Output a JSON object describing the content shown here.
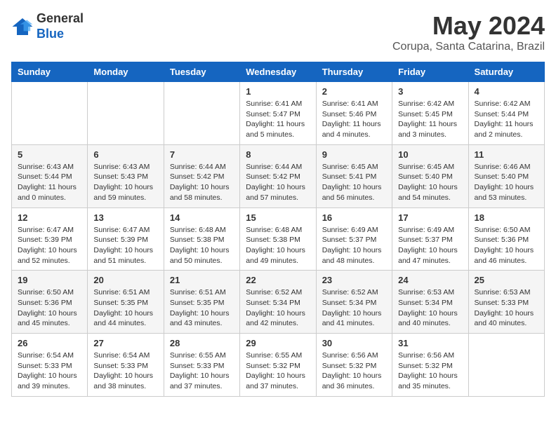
{
  "logo": {
    "general": "General",
    "blue": "Blue"
  },
  "title": "May 2024",
  "location": "Corupa, Santa Catarina, Brazil",
  "weekdays": [
    "Sunday",
    "Monday",
    "Tuesday",
    "Wednesday",
    "Thursday",
    "Friday",
    "Saturday"
  ],
  "weeks": [
    [
      {
        "day": "",
        "sunrise": "",
        "sunset": "",
        "daylight": ""
      },
      {
        "day": "",
        "sunrise": "",
        "sunset": "",
        "daylight": ""
      },
      {
        "day": "",
        "sunrise": "",
        "sunset": "",
        "daylight": ""
      },
      {
        "day": "1",
        "sunrise": "Sunrise: 6:41 AM",
        "sunset": "Sunset: 5:47 PM",
        "daylight": "Daylight: 11 hours and 5 minutes."
      },
      {
        "day": "2",
        "sunrise": "Sunrise: 6:41 AM",
        "sunset": "Sunset: 5:46 PM",
        "daylight": "Daylight: 11 hours and 4 minutes."
      },
      {
        "day": "3",
        "sunrise": "Sunrise: 6:42 AM",
        "sunset": "Sunset: 5:45 PM",
        "daylight": "Daylight: 11 hours and 3 minutes."
      },
      {
        "day": "4",
        "sunrise": "Sunrise: 6:42 AM",
        "sunset": "Sunset: 5:44 PM",
        "daylight": "Daylight: 11 hours and 2 minutes."
      }
    ],
    [
      {
        "day": "5",
        "sunrise": "Sunrise: 6:43 AM",
        "sunset": "Sunset: 5:44 PM",
        "daylight": "Daylight: 11 hours and 0 minutes."
      },
      {
        "day": "6",
        "sunrise": "Sunrise: 6:43 AM",
        "sunset": "Sunset: 5:43 PM",
        "daylight": "Daylight: 10 hours and 59 minutes."
      },
      {
        "day": "7",
        "sunrise": "Sunrise: 6:44 AM",
        "sunset": "Sunset: 5:42 PM",
        "daylight": "Daylight: 10 hours and 58 minutes."
      },
      {
        "day": "8",
        "sunrise": "Sunrise: 6:44 AM",
        "sunset": "Sunset: 5:42 PM",
        "daylight": "Daylight: 10 hours and 57 minutes."
      },
      {
        "day": "9",
        "sunrise": "Sunrise: 6:45 AM",
        "sunset": "Sunset: 5:41 PM",
        "daylight": "Daylight: 10 hours and 56 minutes."
      },
      {
        "day": "10",
        "sunrise": "Sunrise: 6:45 AM",
        "sunset": "Sunset: 5:40 PM",
        "daylight": "Daylight: 10 hours and 54 minutes."
      },
      {
        "day": "11",
        "sunrise": "Sunrise: 6:46 AM",
        "sunset": "Sunset: 5:40 PM",
        "daylight": "Daylight: 10 hours and 53 minutes."
      }
    ],
    [
      {
        "day": "12",
        "sunrise": "Sunrise: 6:47 AM",
        "sunset": "Sunset: 5:39 PM",
        "daylight": "Daylight: 10 hours and 52 minutes."
      },
      {
        "day": "13",
        "sunrise": "Sunrise: 6:47 AM",
        "sunset": "Sunset: 5:39 PM",
        "daylight": "Daylight: 10 hours and 51 minutes."
      },
      {
        "day": "14",
        "sunrise": "Sunrise: 6:48 AM",
        "sunset": "Sunset: 5:38 PM",
        "daylight": "Daylight: 10 hours and 50 minutes."
      },
      {
        "day": "15",
        "sunrise": "Sunrise: 6:48 AM",
        "sunset": "Sunset: 5:38 PM",
        "daylight": "Daylight: 10 hours and 49 minutes."
      },
      {
        "day": "16",
        "sunrise": "Sunrise: 6:49 AM",
        "sunset": "Sunset: 5:37 PM",
        "daylight": "Daylight: 10 hours and 48 minutes."
      },
      {
        "day": "17",
        "sunrise": "Sunrise: 6:49 AM",
        "sunset": "Sunset: 5:37 PM",
        "daylight": "Daylight: 10 hours and 47 minutes."
      },
      {
        "day": "18",
        "sunrise": "Sunrise: 6:50 AM",
        "sunset": "Sunset: 5:36 PM",
        "daylight": "Daylight: 10 hours and 46 minutes."
      }
    ],
    [
      {
        "day": "19",
        "sunrise": "Sunrise: 6:50 AM",
        "sunset": "Sunset: 5:36 PM",
        "daylight": "Daylight: 10 hours and 45 minutes."
      },
      {
        "day": "20",
        "sunrise": "Sunrise: 6:51 AM",
        "sunset": "Sunset: 5:35 PM",
        "daylight": "Daylight: 10 hours and 44 minutes."
      },
      {
        "day": "21",
        "sunrise": "Sunrise: 6:51 AM",
        "sunset": "Sunset: 5:35 PM",
        "daylight": "Daylight: 10 hours and 43 minutes."
      },
      {
        "day": "22",
        "sunrise": "Sunrise: 6:52 AM",
        "sunset": "Sunset: 5:34 PM",
        "daylight": "Daylight: 10 hours and 42 minutes."
      },
      {
        "day": "23",
        "sunrise": "Sunrise: 6:52 AM",
        "sunset": "Sunset: 5:34 PM",
        "daylight": "Daylight: 10 hours and 41 minutes."
      },
      {
        "day": "24",
        "sunrise": "Sunrise: 6:53 AM",
        "sunset": "Sunset: 5:34 PM",
        "daylight": "Daylight: 10 hours and 40 minutes."
      },
      {
        "day": "25",
        "sunrise": "Sunrise: 6:53 AM",
        "sunset": "Sunset: 5:33 PM",
        "daylight": "Daylight: 10 hours and 40 minutes."
      }
    ],
    [
      {
        "day": "26",
        "sunrise": "Sunrise: 6:54 AM",
        "sunset": "Sunset: 5:33 PM",
        "daylight": "Daylight: 10 hours and 39 minutes."
      },
      {
        "day": "27",
        "sunrise": "Sunrise: 6:54 AM",
        "sunset": "Sunset: 5:33 PM",
        "daylight": "Daylight: 10 hours and 38 minutes."
      },
      {
        "day": "28",
        "sunrise": "Sunrise: 6:55 AM",
        "sunset": "Sunset: 5:33 PM",
        "daylight": "Daylight: 10 hours and 37 minutes."
      },
      {
        "day": "29",
        "sunrise": "Sunrise: 6:55 AM",
        "sunset": "Sunset: 5:32 PM",
        "daylight": "Daylight: 10 hours and 37 minutes."
      },
      {
        "day": "30",
        "sunrise": "Sunrise: 6:56 AM",
        "sunset": "Sunset: 5:32 PM",
        "daylight": "Daylight: 10 hours and 36 minutes."
      },
      {
        "day": "31",
        "sunrise": "Sunrise: 6:56 AM",
        "sunset": "Sunset: 5:32 PM",
        "daylight": "Daylight: 10 hours and 35 minutes."
      },
      {
        "day": "",
        "sunrise": "",
        "sunset": "",
        "daylight": ""
      }
    ]
  ]
}
